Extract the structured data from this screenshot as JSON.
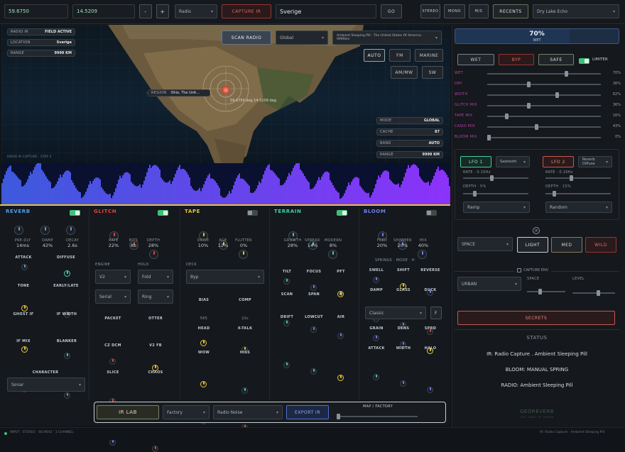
{
  "topbar": {
    "lat": "59.6750",
    "lon": "14.5209",
    "minus": "-",
    "plus": "+",
    "source_select": "Radio",
    "capture": "CAPTURE IR",
    "location": "Sverige",
    "go": "GO",
    "stereo": "STEREO",
    "mono": "MONO",
    "ms": "M/S",
    "recents": "RECENTS",
    "preset": "Dry Lake Echo"
  },
  "map": {
    "pills_left": [
      {
        "k": "RADIO IR",
        "v": "FIELD ACTIVE"
      },
      {
        "k": "LOCATION",
        "v": "Sverige"
      },
      {
        "k": "RANGE",
        "v": "9999 KM"
      }
    ],
    "scan": "SCAN RADIO",
    "scope": "Global",
    "station": "Ambient Sleeping Pill · The United States Of America · 9999km",
    "bands": [
      "AUTO",
      "FM",
      "MARINE",
      "AM/MW",
      "SW"
    ],
    "region_k": "REGION",
    "region_v": "Ohio, The Unit...",
    "coords": "59.6750 deg  14.5209 deg",
    "pills_right": [
      {
        "k": "MODE",
        "v": "GLOBAL"
      },
      {
        "k": "CACHE",
        "v": "87"
      },
      {
        "k": "BAND",
        "v": "AUTO"
      },
      {
        "k": "RANGE",
        "v": "9999 KM"
      }
    ],
    "footnote": "RADIO IR CAPTURE · STEP 3"
  },
  "modules": {
    "reverb": {
      "title": "REVERB",
      "k": [
        {
          "l": "PRE-DLY",
          "v": "14ms"
        },
        {
          "l": "DAMP",
          "v": "42%"
        },
        {
          "l": "DECAY",
          "v": "2.6s"
        }
      ],
      "s": [
        "ATTACK",
        "DIFFUSE",
        "TONE",
        "EARLY/LATE",
        "GHOST IF",
        "IF WIDTH",
        "IF MIX",
        "BLANKER"
      ],
      "char_label": "CHARACTER",
      "char": "Sonar"
    },
    "glitch": {
      "title": "GLITCH",
      "k": [
        {
          "l": "RATE",
          "v": "22%"
        },
        {
          "l": "BITS",
          "v": "8b"
        },
        {
          "l": "DEPTH",
          "v": "28%"
        }
      ],
      "l1": "ENGINE",
      "l2": "HOLD",
      "e": "V2",
      "h": "Fold",
      "e2": "Serial",
      "h2": "Ring",
      "s": [
        "PACKET",
        "OTTER",
        "CZ DCM",
        "V2 FB",
        "SLICE",
        "CHAOS"
      ]
    },
    "tape": {
      "title": "TAPE",
      "k": [
        {
          "l": "DRIVE",
          "v": "10%"
        },
        {
          "l": "AGE",
          "v": "12%"
        },
        {
          "l": "FLUTTER",
          "v": "0%"
        }
      ],
      "deck_label": "DECK",
      "deck": "Byp",
      "s": [
        {
          "l": "BIAS",
          "v": "565"
        },
        {
          "l": "COMP",
          "v": "22s"
        },
        {
          "l": "HEAD",
          "v": ""
        },
        {
          "l": "X-TALK",
          "v": ""
        },
        {
          "l": "WOW",
          "v": ""
        },
        {
          "l": "HISS",
          "v": ""
        }
      ]
    },
    "terrain": {
      "title": "TERRAIN",
      "k": [
        {
          "l": "GROWTH",
          "v": "28%"
        },
        {
          "l": "SPREAD",
          "v": "14%"
        },
        {
          "l": "MODERN",
          "v": "8%"
        }
      ],
      "s": [
        "TILT",
        "FOCUS",
        "PFT",
        "SCAN",
        "SPAN",
        "Q",
        "DRIFT",
        "LOWCUT",
        "AIR"
      ]
    },
    "bloom": {
      "title": "BLOOM",
      "k": [
        {
          "l": "FEED",
          "v": "20%"
        },
        {
          "l": "SHIMMER",
          "v": "20%"
        },
        {
          "l": "MIX",
          "v": "40%"
        }
      ],
      "sub": "SPRINGS · MODE · H",
      "s": [
        "SWELL",
        "SHIFT",
        "REVERSE",
        "DAMP",
        "GLASS",
        "DUCK"
      ],
      "mode": "Classic",
      "f": "F",
      "s2": [
        "GRAIN",
        "DENS",
        "SPRD",
        "ATTACK",
        "WIDTH",
        "HALO"
      ]
    }
  },
  "bottombar": {
    "irlab": "IR LAB",
    "factory": "Factory",
    "noise": "Radio Noise",
    "export": "EXPORT IR",
    "map_label": "MAP / FACTORY"
  },
  "status_footer": {
    "left": "INPUT · STEREO · 48.0KHZ · 1 CHANNEL",
    "right": "IR: Radio Capture · Ambient Sleeping Pill"
  },
  "right": {
    "wet_pct": "70%",
    "wet_label": "WET",
    "wet_fill": 0.7,
    "modes": [
      "WET",
      "BYP",
      "SAFE"
    ],
    "limiter": "LIMITER",
    "sliders": [
      {
        "l": "WET",
        "v": "70%",
        "f": 0.7
      },
      {
        "l": "DRY",
        "v": "36%",
        "f": 0.36
      },
      {
        "l": "WIDTH",
        "v": "62%",
        "f": 0.62
      },
      {
        "l": "GLITCH MIX",
        "v": "36%",
        "f": 0.36
      },
      {
        "l": "TAPE MIX",
        "v": "16%",
        "f": 0.16
      },
      {
        "l": "CASIO MIX",
        "v": "43%",
        "f": 0.43
      },
      {
        "l": "BLOOM MIX",
        "v": "0%",
        "f": 0.0
      }
    ],
    "lfo1": {
      "btn": "LFO 1",
      "sel": "Sawtooth",
      "r1": "RATE · 0.15Hz",
      "r2": "DEPTH · 5%",
      "shape": "Ramp"
    },
    "lfo2": {
      "btn": "LFO 2",
      "sel": "Reverb Diffuse",
      "r1": "RATE · 0.10Hz",
      "r2": "DEPTH · 15%",
      "shape": "Random"
    },
    "space": "SPACE",
    "light": "LIGHT",
    "med": "MED",
    "wild": "WILD",
    "capture": "CAPTURE ENV",
    "urban": "URBAN",
    "sp1": "SPACE",
    "sp2": "LEVEL",
    "secrets": "SECRETS",
    "status_h": "STATUS",
    "status_lines": [
      "IR: Radio Capture . Ambient Sleeping Pill",
      "BLOOM: MANUAL SPRING",
      "RADIO: Ambient Sleeping Pill"
    ],
    "logo": "GEOREVERB",
    "logo_sub": "GEO · RADIO · IR · REVERB"
  },
  "colors": {
    "reverb": "#4fa0ea",
    "glitch": "#e3453c",
    "tape": "#e8c530",
    "terrain": "#3fd0a5",
    "bloom": "#6f7ef0"
  }
}
